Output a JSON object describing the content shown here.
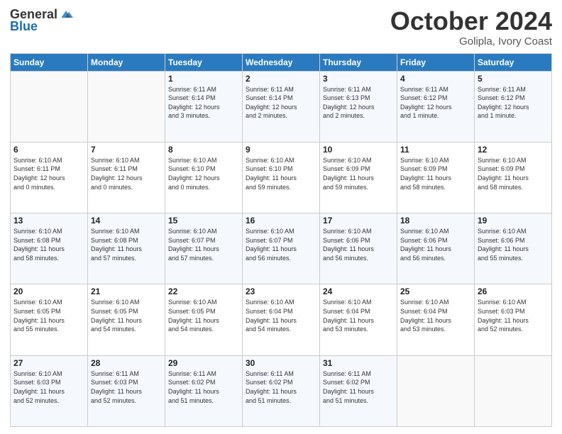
{
  "header": {
    "logo": {
      "general": "General",
      "blue": "Blue"
    },
    "title": "October 2024",
    "location": "Golipla, Ivory Coast"
  },
  "calendar": {
    "days_of_week": [
      "Sunday",
      "Monday",
      "Tuesday",
      "Wednesday",
      "Thursday",
      "Friday",
      "Saturday"
    ],
    "weeks": [
      [
        {
          "day": "",
          "info": ""
        },
        {
          "day": "",
          "info": ""
        },
        {
          "day": "1",
          "info": "Sunrise: 6:11 AM\nSunset: 6:14 PM\nDaylight: 12 hours\nand 3 minutes."
        },
        {
          "day": "2",
          "info": "Sunrise: 6:11 AM\nSunset: 6:14 PM\nDaylight: 12 hours\nand 2 minutes."
        },
        {
          "day": "3",
          "info": "Sunrise: 6:11 AM\nSunset: 6:13 PM\nDaylight: 12 hours\nand 2 minutes."
        },
        {
          "day": "4",
          "info": "Sunrise: 6:11 AM\nSunset: 6:12 PM\nDaylight: 12 hours\nand 1 minute."
        },
        {
          "day": "5",
          "info": "Sunrise: 6:11 AM\nSunset: 6:12 PM\nDaylight: 12 hours\nand 1 minute."
        }
      ],
      [
        {
          "day": "6",
          "info": "Sunrise: 6:10 AM\nSunset: 6:11 PM\nDaylight: 12 hours\nand 0 minutes."
        },
        {
          "day": "7",
          "info": "Sunrise: 6:10 AM\nSunset: 6:11 PM\nDaylight: 12 hours\nand 0 minutes."
        },
        {
          "day": "8",
          "info": "Sunrise: 6:10 AM\nSunset: 6:10 PM\nDaylight: 12 hours\nand 0 minutes."
        },
        {
          "day": "9",
          "info": "Sunrise: 6:10 AM\nSunset: 6:10 PM\nDaylight: 11 hours\nand 59 minutes."
        },
        {
          "day": "10",
          "info": "Sunrise: 6:10 AM\nSunset: 6:09 PM\nDaylight: 11 hours\nand 59 minutes."
        },
        {
          "day": "11",
          "info": "Sunrise: 6:10 AM\nSunset: 6:09 PM\nDaylight: 11 hours\nand 58 minutes."
        },
        {
          "day": "12",
          "info": "Sunrise: 6:10 AM\nSunset: 6:09 PM\nDaylight: 11 hours\nand 58 minutes."
        }
      ],
      [
        {
          "day": "13",
          "info": "Sunrise: 6:10 AM\nSunset: 6:08 PM\nDaylight: 11 hours\nand 58 minutes."
        },
        {
          "day": "14",
          "info": "Sunrise: 6:10 AM\nSunset: 6:08 PM\nDaylight: 11 hours\nand 57 minutes."
        },
        {
          "day": "15",
          "info": "Sunrise: 6:10 AM\nSunset: 6:07 PM\nDaylight: 11 hours\nand 57 minutes."
        },
        {
          "day": "16",
          "info": "Sunrise: 6:10 AM\nSunset: 6:07 PM\nDaylight: 11 hours\nand 56 minutes."
        },
        {
          "day": "17",
          "info": "Sunrise: 6:10 AM\nSunset: 6:06 PM\nDaylight: 11 hours\nand 56 minutes."
        },
        {
          "day": "18",
          "info": "Sunrise: 6:10 AM\nSunset: 6:06 PM\nDaylight: 11 hours\nand 56 minutes."
        },
        {
          "day": "19",
          "info": "Sunrise: 6:10 AM\nSunset: 6:06 PM\nDaylight: 11 hours\nand 55 minutes."
        }
      ],
      [
        {
          "day": "20",
          "info": "Sunrise: 6:10 AM\nSunset: 6:05 PM\nDaylight: 11 hours\nand 55 minutes."
        },
        {
          "day": "21",
          "info": "Sunrise: 6:10 AM\nSunset: 6:05 PM\nDaylight: 11 hours\nand 54 minutes."
        },
        {
          "day": "22",
          "info": "Sunrise: 6:10 AM\nSunset: 6:05 PM\nDaylight: 11 hours\nand 54 minutes."
        },
        {
          "day": "23",
          "info": "Sunrise: 6:10 AM\nSunset: 6:04 PM\nDaylight: 11 hours\nand 54 minutes."
        },
        {
          "day": "24",
          "info": "Sunrise: 6:10 AM\nSunset: 6:04 PM\nDaylight: 11 hours\nand 53 minutes."
        },
        {
          "day": "25",
          "info": "Sunrise: 6:10 AM\nSunset: 6:04 PM\nDaylight: 11 hours\nand 53 minutes."
        },
        {
          "day": "26",
          "info": "Sunrise: 6:10 AM\nSunset: 6:03 PM\nDaylight: 11 hours\nand 52 minutes."
        }
      ],
      [
        {
          "day": "27",
          "info": "Sunrise: 6:10 AM\nSunset: 6:03 PM\nDaylight: 11 hours\nand 52 minutes."
        },
        {
          "day": "28",
          "info": "Sunrise: 6:11 AM\nSunset: 6:03 PM\nDaylight: 11 hours\nand 52 minutes."
        },
        {
          "day": "29",
          "info": "Sunrise: 6:11 AM\nSunset: 6:02 PM\nDaylight: 11 hours\nand 51 minutes."
        },
        {
          "day": "30",
          "info": "Sunrise: 6:11 AM\nSunset: 6:02 PM\nDaylight: 11 hours\nand 51 minutes."
        },
        {
          "day": "31",
          "info": "Sunrise: 6:11 AM\nSunset: 6:02 PM\nDaylight: 11 hours\nand 51 minutes."
        },
        {
          "day": "",
          "info": ""
        },
        {
          "day": "",
          "info": ""
        }
      ]
    ]
  }
}
